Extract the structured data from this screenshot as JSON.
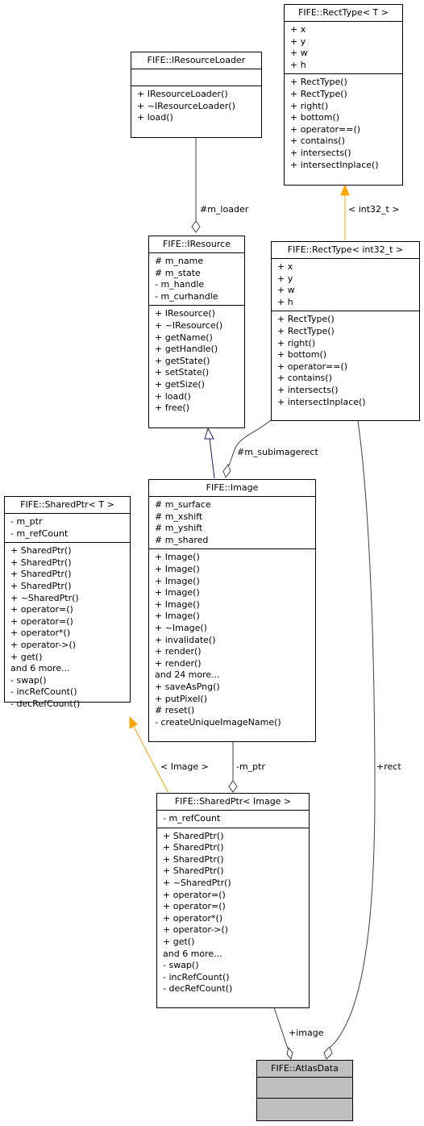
{
  "diagram": {
    "type": "uml-class-collaboration",
    "classes": {
      "recttype_t": {
        "name": "FIFE::RectType< T >",
        "attributes": [
          "+ x",
          "+ y",
          "+ w",
          "+ h"
        ],
        "methods": [
          "+ RectType()",
          "+ RectType()",
          "+ right()",
          "+ bottom()",
          "+ operator==()",
          "+ contains()",
          "+ intersects()",
          "+ intersectInplace()"
        ]
      },
      "iresourceloader": {
        "name": "FIFE::IResourceLoader",
        "attributes": [],
        "methods": [
          "+ IResourceLoader()",
          "+ ~IResourceLoader()",
          "+ load()"
        ]
      },
      "iresource": {
        "name": "FIFE::IResource",
        "attributes": [
          "# m_name",
          "# m_state",
          "- m_handle",
          "- m_curhandle"
        ],
        "methods": [
          "+ IResource()",
          "+ ~IResource()",
          "+ getName()",
          "+ getHandle()",
          "+ getState()",
          "+ setState()",
          "+ getSize()",
          "+ load()",
          "+ free()"
        ]
      },
      "recttype_int32": {
        "name": "FIFE::RectType< int32_t >",
        "attributes": [
          "+ x",
          "+ y",
          "+ w",
          "+ h"
        ],
        "methods": [
          "+ RectType()",
          "+ RectType()",
          "+ right()",
          "+ bottom()",
          "+ operator==()",
          "+ contains()",
          "+ intersects()",
          "+ intersectInplace()"
        ]
      },
      "sharedptr_t": {
        "name": "FIFE::SharedPtr< T >",
        "attributes": [
          "- m_ptr",
          "- m_refCount"
        ],
        "methods": [
          "+ SharedPtr()",
          "+ SharedPtr()",
          "+ SharedPtr()",
          "+ SharedPtr()",
          "+ ~SharedPtr()",
          "+ operator=()",
          "+ operator=()",
          "+ operator*()",
          "+ operator->()",
          "+ get()",
          "and 6 more...",
          "- swap()",
          "- incRefCount()",
          "- decRefCount()"
        ]
      },
      "image": {
        "name": "FIFE::Image",
        "attributes": [
          "# m_surface",
          "# m_xshift",
          "# m_yshift",
          "# m_shared"
        ],
        "methods": [
          "+ Image()",
          "+ Image()",
          "+ Image()",
          "+ Image()",
          "+ Image()",
          "+ Image()",
          "+ ~Image()",
          "+ invalidate()",
          "+ render()",
          "+ render()",
          "and 24 more...",
          "+ saveAsPng()",
          "+ putPixel()",
          "# reset()",
          "- createUniqueImageName()"
        ]
      },
      "sharedptr_image": {
        "name": "FIFE::SharedPtr< Image >",
        "attributes": [
          "- m_refCount"
        ],
        "methods": [
          "+ SharedPtr()",
          "+ SharedPtr()",
          "+ SharedPtr()",
          "+ SharedPtr()",
          "+ ~SharedPtr()",
          "+ operator=()",
          "+ operator=()",
          "+ operator*()",
          "+ operator->()",
          "+ get()",
          "and 6 more...",
          "- swap()",
          "- incRefCount()",
          "- decRefCount()"
        ]
      },
      "atlasdata": {
        "name": "FIFE::AtlasData",
        "attributes": [],
        "methods": []
      }
    },
    "edges": [
      {
        "from": "iresourceloader",
        "to": "iresource",
        "kind": "aggregation",
        "label": "#m_loader"
      },
      {
        "from": "recttype_int32",
        "to": "recttype_t",
        "kind": "template-instantiation",
        "label": "< int32_t >"
      },
      {
        "from": "image",
        "to": "iresource",
        "kind": "inheritance",
        "label": ""
      },
      {
        "from": "recttype_int32",
        "to": "image",
        "kind": "aggregation",
        "label": "#m_subimagerect"
      },
      {
        "from": "sharedptr_image",
        "to": "sharedptr_t",
        "kind": "template-instantiation",
        "label": "< Image >"
      },
      {
        "from": "image",
        "to": "sharedptr_image",
        "kind": "aggregation",
        "label": "-m_ptr"
      },
      {
        "from": "sharedptr_image",
        "to": "atlasdata",
        "kind": "aggregation",
        "label": "+image"
      },
      {
        "from": "recttype_int32",
        "to": "atlasdata",
        "kind": "aggregation",
        "label": "+rect"
      }
    ],
    "colors": {
      "inheritance": "#191970",
      "template": "#ffa500",
      "association": "#404040",
      "highlight_fill": "#bfbfbf"
    }
  }
}
